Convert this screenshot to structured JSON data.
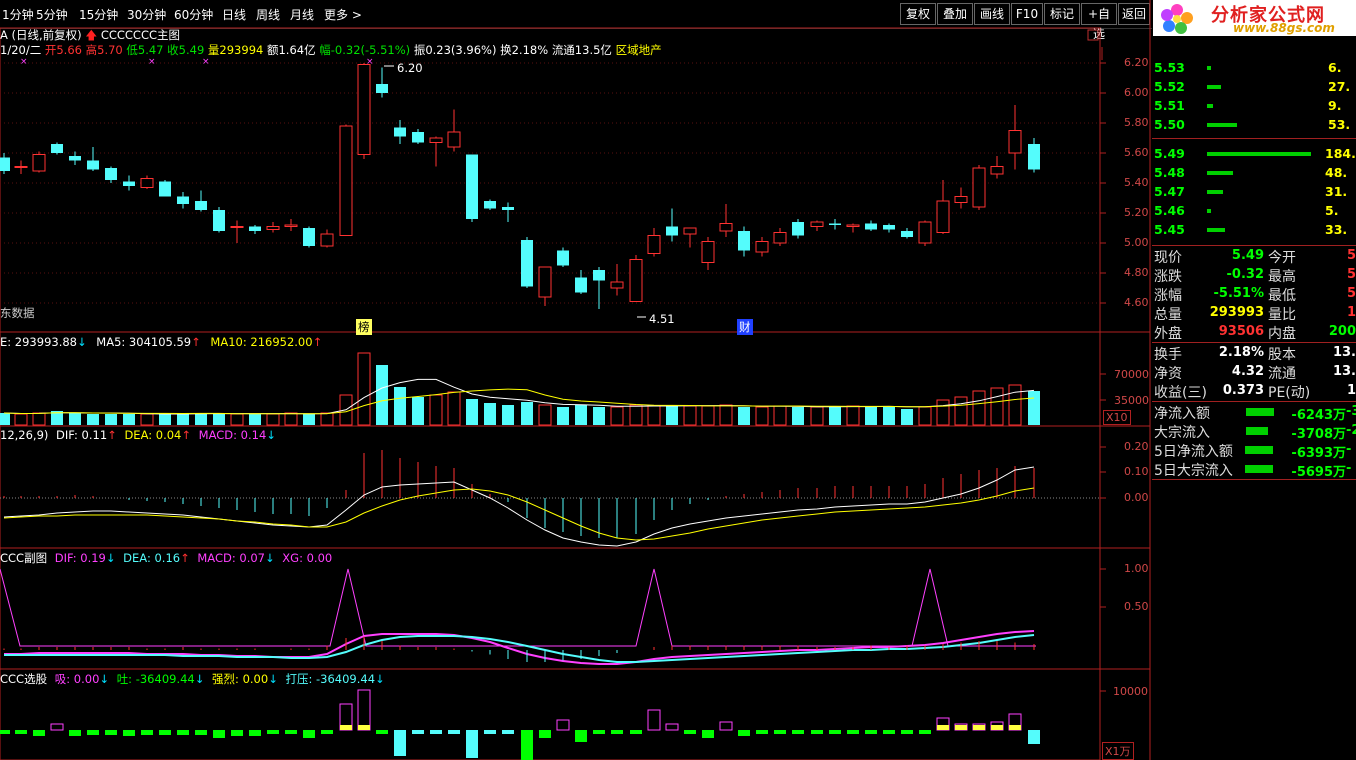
{
  "toolbar": {
    "periods": [
      "1分钟",
      "5分钟",
      "15分钟",
      "30分钟",
      "60分钟",
      "日线",
      "周线",
      "月线",
      "更多 >"
    ],
    "right_buttons": [
      "复权",
      "叠加",
      "画线",
      "F10",
      "标记",
      "+自选",
      "返回"
    ]
  },
  "header": {
    "line1_title": "(日线,前复权)",
    "line1_indicator": "CCCCCCC主图",
    "date": "1/20/二",
    "open": "开5.66",
    "high": "高5.70",
    "low": "低5.47",
    "close": "收5.49",
    "volume": "量293994",
    "amount": "额1.64亿",
    "change": "幅-0.32(-5.51%)",
    "amplitude": "振0.23(3.96%)",
    "turnover": "换2.18%",
    "float": "流通13.5亿",
    "sector": "区域地产"
  },
  "main_chart": {
    "price_labels": [
      "6.20",
      "6.00",
      "5.80",
      "5.60",
      "5.40",
      "5.20",
      "5.00",
      "4.80",
      "4.60"
    ],
    "high_mark": "6.20",
    "low_mark": "4.51",
    "bottom_left": "东数据",
    "event_tags": [
      "榜",
      "财"
    ]
  },
  "vol_panel": {
    "label_vol": "E: 293993.88",
    "label_ma5": "MA5: 304105.59",
    "label_ma10": "MA10: 216952.00",
    "axis": [
      "70000",
      "35000"
    ],
    "unit": "X10"
  },
  "macd_panel": {
    "label_param": "12,26,9)",
    "label_dif": "DIF: 0.11",
    "label_dea": "DEA: 0.04",
    "label_macd": "MACD: 0.14",
    "axis": [
      "0.20",
      "0.10",
      "0.00"
    ]
  },
  "sub_panel": {
    "label_name": "CCC副图",
    "label_dif": "DIF: 0.19",
    "label_dea": "DEA: 0.16",
    "label_macd": "MACD: 0.07",
    "label_xg": "XG: 0.00",
    "axis": [
      "1.00",
      "0.50"
    ]
  },
  "select_panel": {
    "label_name": "CCC选股",
    "label_xi": "吸: 0.00",
    "label_tu": "吐: -36409.44",
    "label_qiang": "强烈: 0.00",
    "label_daya": "打压: -36409.44",
    "axis": [
      "10000"
    ],
    "unit": "X1万"
  },
  "logo": {
    "text": "分析家公式网",
    "url": "www.88gs.com"
  },
  "order_book": {
    "asks": [
      {
        "price": "5.53",
        "vol": "6."
      },
      {
        "price": "5.52",
        "vol": "27."
      },
      {
        "price": "5.51",
        "vol": "9."
      },
      {
        "price": "5.50",
        "vol": "53."
      }
    ],
    "bids": [
      {
        "price": "5.49",
        "vol": "184."
      },
      {
        "price": "5.48",
        "vol": "48."
      },
      {
        "price": "5.47",
        "vol": "31."
      },
      {
        "price": "5.46",
        "vol": "5."
      },
      {
        "price": "5.45",
        "vol": "33."
      }
    ]
  },
  "quote": [
    {
      "l1": "现价",
      "v1": "5.49",
      "l2": "今开",
      "v2": "5"
    },
    {
      "l1": "涨跌",
      "v1": "-0.32",
      "l2": "最高",
      "v2": "5"
    },
    {
      "l1": "涨幅",
      "v1": "-5.51%",
      "l2": "最低",
      "v2": "5"
    },
    {
      "l1": "总量",
      "v1": "293993",
      "l2": "量比",
      "v2": "1"
    },
    {
      "l1": "外盘",
      "v1": "93506",
      "l2": "内盘",
      "v2": "200"
    }
  ],
  "quote2": [
    {
      "l1": "换手",
      "v1": "2.18%",
      "l2": "股本",
      "v2": "13."
    },
    {
      "l1": "净资",
      "v1": "4.32",
      "l2": "流通",
      "v2": "13."
    },
    {
      "l1": "收益(三)",
      "v1": "0.373",
      "l2": "PE(动)",
      "v2": "1"
    }
  ],
  "flows": [
    {
      "label": "净流入额",
      "value": "-6243万",
      "extra": "-3"
    },
    {
      "label": "大宗流入",
      "value": "-3708万",
      "extra": "-2"
    },
    {
      "label": "5日净流入额",
      "value": "-6393万",
      "extra": "-"
    },
    {
      "label": "5日大宗流入",
      "value": "-5695万",
      "extra": "-"
    }
  ],
  "colors": {
    "up": "#ff3232",
    "down": "#54fcfc",
    "axis": "#b02020",
    "green": "#00ff00",
    "yellow": "#ffff00",
    "magenta": "#ff00ff"
  }
}
